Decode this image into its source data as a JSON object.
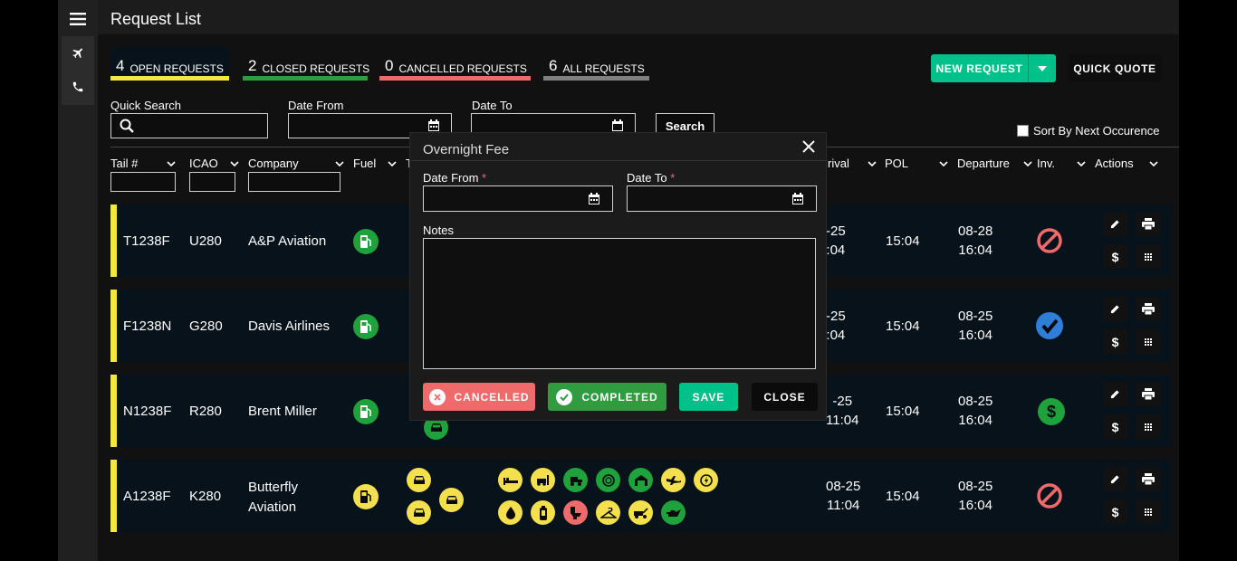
{
  "header": {
    "title": "Request List"
  },
  "tabs": [
    {
      "count": "4",
      "label": "OPEN REQUESTS",
      "color": "#f5e642"
    },
    {
      "count": "2",
      "label": "CLOSED REQUESTS",
      "color": "#2e9c3f"
    },
    {
      "count": "0",
      "label": "CANCELLED REQUESTS",
      "color": "#ef6a6a"
    },
    {
      "count": "6",
      "label": "ALL REQUESTS",
      "color": "#808080"
    }
  ],
  "toolbar": {
    "new_request": "NEW REQUEST",
    "quick_quote": "QUICK QUOTE"
  },
  "filters": {
    "quick_search": "Quick Search",
    "date_from": "Date From",
    "date_to": "Date To",
    "search_button": "Search",
    "sort_next": "Sort By Next Occurence"
  },
  "columns": {
    "tail": "Tail #",
    "icao": "ICAO",
    "company": "Company",
    "fuel": "Fuel",
    "t": "T",
    "arrival": "rival",
    "pol": "POL",
    "departure": "Departure",
    "inv": "Inv.",
    "actions": "Actions"
  },
  "rows": [
    {
      "tail": "T1238F",
      "icao": "U280",
      "company": "A&P Aviation",
      "company2": "",
      "arr1": "-25",
      "arr2": ":04",
      "pol": "15:04",
      "dep1": "08-28",
      "dep2": "16:04",
      "dep_green": false,
      "inv": "cancel"
    },
    {
      "tail": "F1238N",
      "icao": "G280",
      "company": "Davis Airlines",
      "company2": "",
      "arr1": "-25",
      "arr2": ":04",
      "pol": "15:04",
      "dep1": "08-25",
      "dep2": "16:04",
      "dep_green": true,
      "inv": "check"
    },
    {
      "tail": "N1238F",
      "icao": "R280",
      "company": "Brent Miller",
      "company2": "",
      "arr1": "-25",
      "arr2": "11:04",
      "pol": "15:04",
      "dep1": "08-25",
      "dep2": "16:04",
      "dep_green": false,
      "inv": "dollar"
    },
    {
      "tail": "A1238F",
      "icao": "K280",
      "company": "Butterfly",
      "company2": "Aviation",
      "arr1": "08-25",
      "arr2": "11:04",
      "pol": "15:04",
      "dep1": "08-25",
      "dep2": "16:04",
      "dep_green": false,
      "inv": "cancel"
    }
  ],
  "modal": {
    "title": "Overnight Fee",
    "date_from": "Date From",
    "date_to": "Date To",
    "required_mark": "*",
    "notes": "Notes",
    "btn_cancelled": "CANCELLED",
    "btn_completed": "COMPLETED",
    "btn_save": "SAVE",
    "btn_close": "CLOSE"
  },
  "colors": {
    "accent_green": "#00c18a",
    "open": "#f5e642",
    "closed": "#2e9c3f",
    "cancelled": "#ef6a6a",
    "icon_green": "#1fa13c",
    "icon_yellow": "#f4e04d",
    "check_blue": "#2f7ed8"
  },
  "icons": {
    "row4_services": [
      "bed-icon",
      "forklift-icon",
      "tractor-icon",
      "catering-icon",
      "hangar-icon",
      "plane-tow-icon",
      "power-icon",
      "water-drop-icon",
      "cylinder-icon",
      "lavatory-icon",
      "hanger-cloth-icon",
      "tow-truck-icon",
      "oil-can-icon"
    ]
  }
}
